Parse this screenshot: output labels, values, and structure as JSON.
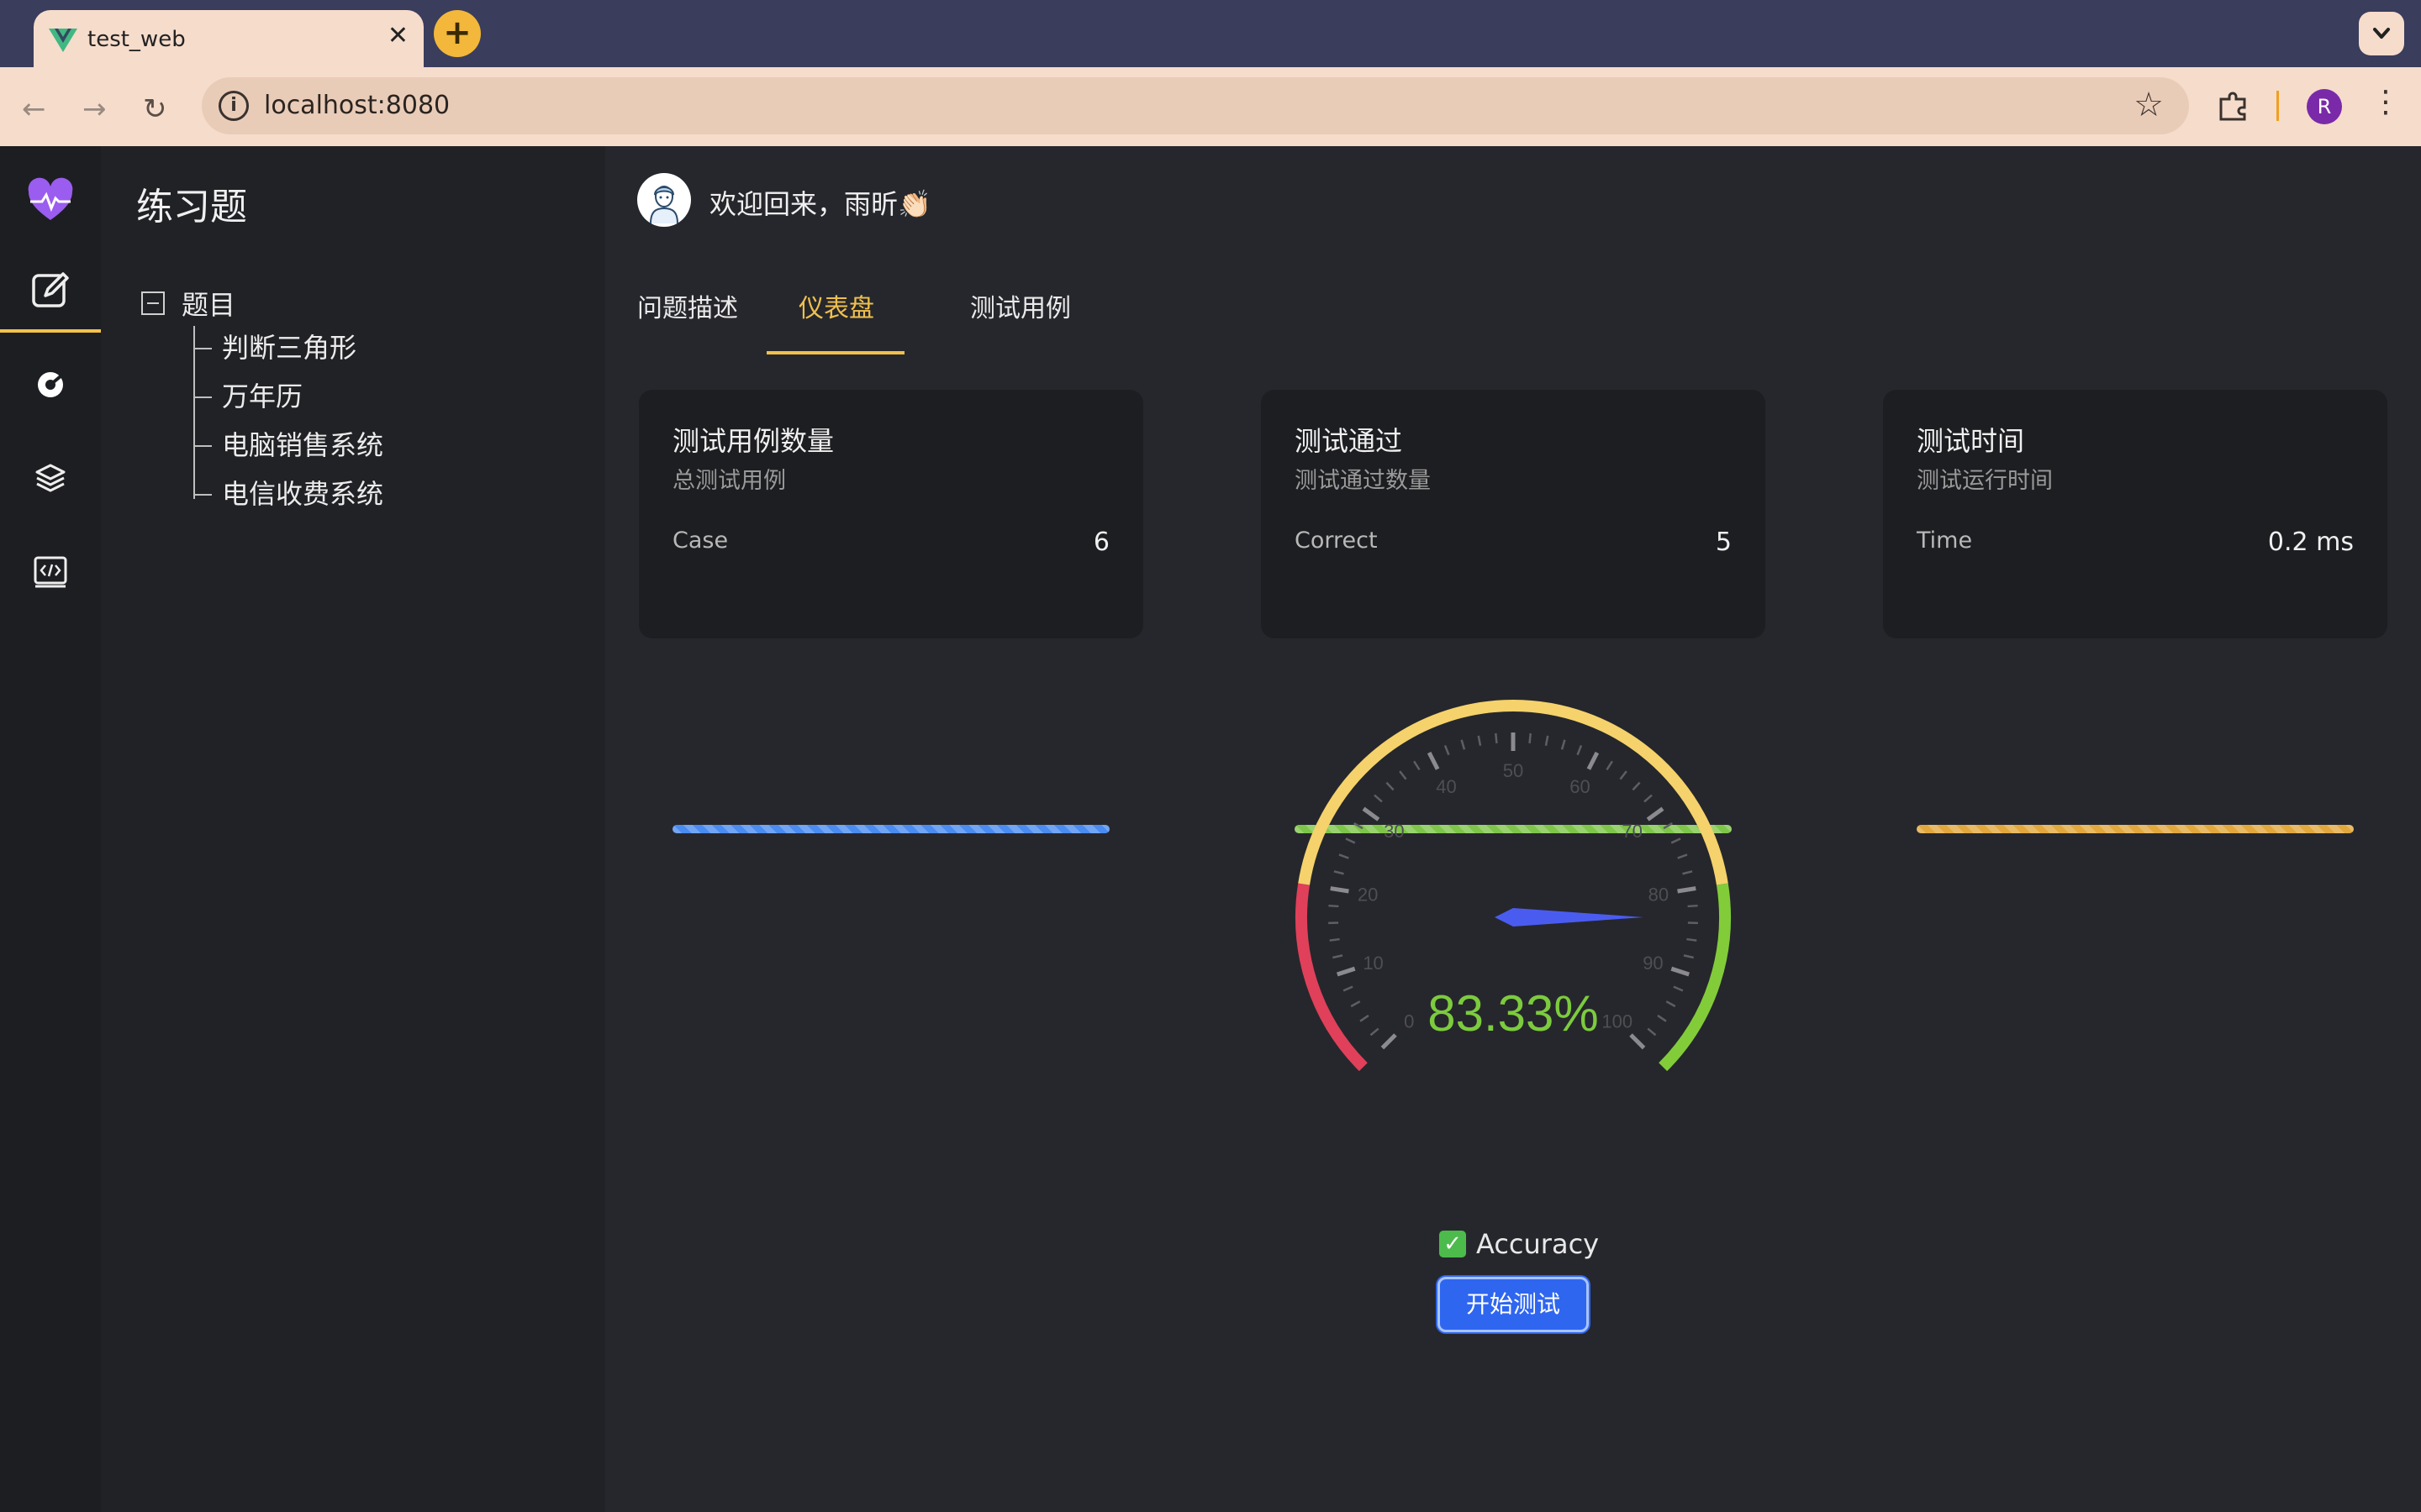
{
  "browser": {
    "tab_title": "test_web",
    "tab_close": "✕",
    "new_tab": "+",
    "url": "localhost:8080",
    "profile_initial": "R"
  },
  "sidebar": {
    "title": "练习题",
    "tree_root": "题目",
    "items": [
      "判断三角形",
      "万年历",
      "电脑销售系统",
      "电信收费系统"
    ]
  },
  "header": {
    "welcome": "欢迎回来，雨昕👏🏻"
  },
  "tabs": [
    "问题描述",
    "仪表盘",
    "测试用例"
  ],
  "active_tab": "仪表盘",
  "cards": [
    {
      "title": "测试用例数量",
      "subtitle": "总测试用例",
      "label": "Case",
      "value": "6",
      "color": "#4a8cf0"
    },
    {
      "title": "测试通过",
      "subtitle": "测试通过数量",
      "label": "Correct",
      "value": "5",
      "color": "#7ec64a"
    },
    {
      "title": "测试时间",
      "subtitle": "测试运行时间",
      "label": "Time",
      "value": "0.2 ms",
      "color": "#e2a83e"
    }
  ],
  "chart_data": {
    "type": "gauge",
    "value": 83.33,
    "value_label": "83.33%",
    "min": 0,
    "max": 100,
    "tick_labels": [
      "0",
      "10",
      "20",
      "30",
      "40",
      "50",
      "60",
      "70",
      "80",
      "90",
      "100"
    ],
    "bands": [
      {
        "from": 0,
        "to": 20,
        "color": "#e0405a"
      },
      {
        "from": 20,
        "to": 80,
        "color": "#f5d26b"
      },
      {
        "from": 80,
        "to": 100,
        "color": "#82cc3a"
      }
    ],
    "legend": "Accuracy",
    "pointer_color": "#4a5cf0"
  },
  "actions": {
    "start_label": "开始测试"
  },
  "colors": {
    "accent": "#f0c04e",
    "button": "#2f66f0"
  }
}
